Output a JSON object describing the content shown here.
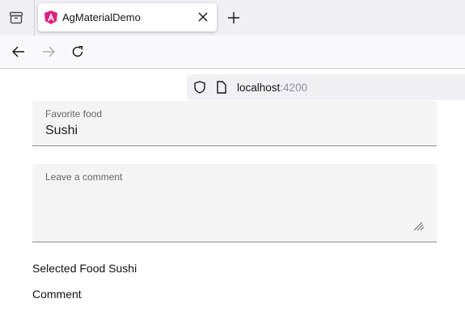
{
  "browser": {
    "tab_title": "AgMaterialDemo",
    "url_host": "localhost",
    "url_port": ":4200"
  },
  "form": {
    "food_label": "Favorite food",
    "food_value": "Sushi",
    "comment_label": "Leave a comment",
    "comment_value": ""
  },
  "output": {
    "selected_food": "Selected Food Sushi",
    "comment": "Comment"
  }
}
